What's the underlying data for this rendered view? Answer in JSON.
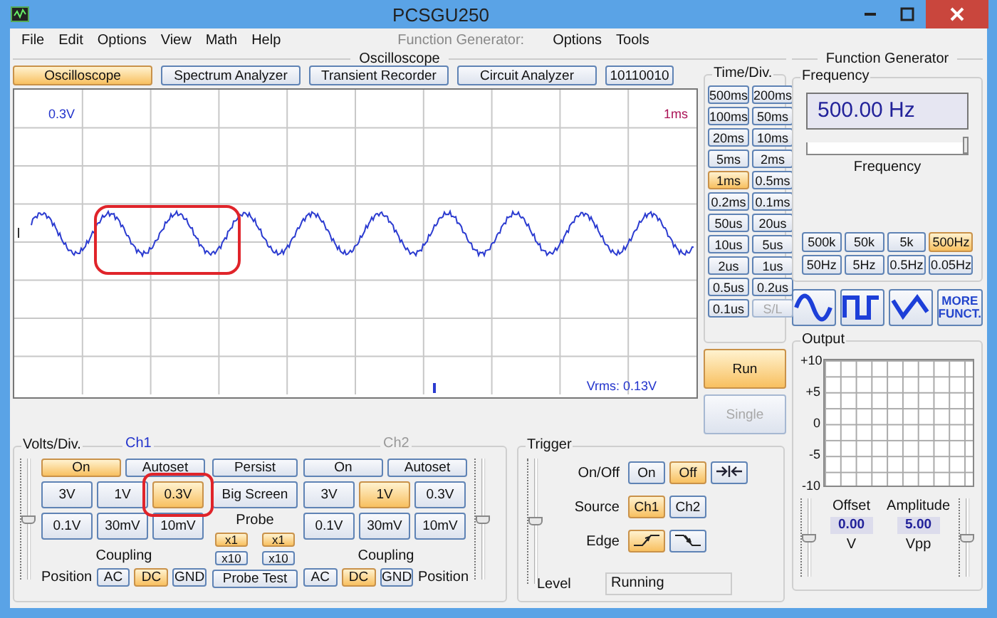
{
  "window": {
    "title": "PCSGU250"
  },
  "menu": [
    "File",
    "Edit",
    "Options",
    "View",
    "Math",
    "Help"
  ],
  "fg_menu": {
    "title": "Function Generator:",
    "items": [
      "Options",
      "Tools"
    ]
  },
  "oscilloscope": {
    "title": "Oscilloscope",
    "tabs": [
      {
        "label": "Oscilloscope",
        "selected": true
      },
      {
        "label": "Spectrum Analyzer",
        "selected": false
      },
      {
        "label": "Transient Recorder",
        "selected": false
      },
      {
        "label": "Circuit Analyzer",
        "selected": false
      },
      {
        "label": "10110010",
        "selected": false
      }
    ],
    "display": {
      "volts_label": "0.3V",
      "time_label": "1ms",
      "vrms": "Vrms: 0.13V",
      "highlight": true
    }
  },
  "time_div": {
    "title": "Time/Div.",
    "buttons": [
      {
        "label": "500ms",
        "selected": false,
        "disabled": false
      },
      {
        "label": "200ms",
        "selected": false,
        "disabled": false
      },
      {
        "label": "100ms",
        "selected": false,
        "disabled": false
      },
      {
        "label": "50ms",
        "selected": false,
        "disabled": false
      },
      {
        "label": "20ms",
        "selected": false,
        "disabled": false
      },
      {
        "label": "10ms",
        "selected": false,
        "disabled": false
      },
      {
        "label": "5ms",
        "selected": false,
        "disabled": false
      },
      {
        "label": "2ms",
        "selected": false,
        "disabled": false
      },
      {
        "label": "1ms",
        "selected": true,
        "disabled": false
      },
      {
        "label": "0.5ms",
        "selected": false,
        "disabled": false
      },
      {
        "label": "0.2ms",
        "selected": false,
        "disabled": false
      },
      {
        "label": "0.1ms",
        "selected": false,
        "disabled": false
      },
      {
        "label": "50us",
        "selected": false,
        "disabled": false
      },
      {
        "label": "20us",
        "selected": false,
        "disabled": false
      },
      {
        "label": "10us",
        "selected": false,
        "disabled": false
      },
      {
        "label": "5us",
        "selected": false,
        "disabled": false
      },
      {
        "label": "2us",
        "selected": false,
        "disabled": false
      },
      {
        "label": "1us",
        "selected": false,
        "disabled": false
      },
      {
        "label": "0.5us",
        "selected": false,
        "disabled": false
      },
      {
        "label": "0.2us",
        "selected": false,
        "disabled": false
      },
      {
        "label": "0.1us",
        "selected": false,
        "disabled": false
      },
      {
        "label": "S/L",
        "selected": false,
        "disabled": true
      }
    ],
    "run": {
      "label": "Run",
      "selected": true,
      "disabled": false
    },
    "single": {
      "label": "Single",
      "selected": false,
      "disabled": true
    }
  },
  "volts_div": {
    "title": "Volts/Div.",
    "channels": [
      {
        "title": "Ch1",
        "enabled": true,
        "slider": {
          "level": 0.5
        },
        "on": {
          "label": "On",
          "selected": true
        },
        "autoset": {
          "label": "Autoset"
        },
        "ranges": [
          {
            "label": "3V",
            "selected": false,
            "highlight": false
          },
          {
            "label": "1V",
            "selected": false,
            "highlight": false
          },
          {
            "label": "0.3V",
            "selected": true,
            "highlight": true
          },
          {
            "label": "0.1V",
            "selected": false,
            "highlight": false
          },
          {
            "label": "30mV",
            "selected": false,
            "highlight": false
          },
          {
            "label": "10mV",
            "selected": false,
            "highlight": false
          }
        ],
        "coupling_label": "Coupling",
        "coupling": [
          {
            "label": "AC",
            "selected": false
          },
          {
            "label": "DC",
            "selected": true
          },
          {
            "label": "GND",
            "selected": false
          }
        ],
        "position_label": "Position"
      },
      {
        "title": "Ch2",
        "enabled": false,
        "slider": {
          "level": 0.5
        },
        "on": {
          "label": "On",
          "selected": false
        },
        "autoset": {
          "label": "Autoset"
        },
        "ranges": [
          {
            "label": "3V",
            "selected": false,
            "highlight": false
          },
          {
            "label": "1V",
            "selected": true,
            "highlight": false
          },
          {
            "label": "0.3V",
            "selected": false,
            "highlight": false
          },
          {
            "label": "0.1V",
            "selected": false,
            "highlight": false
          },
          {
            "label": "30mV",
            "selected": false,
            "highlight": false
          },
          {
            "label": "10mV",
            "selected": false,
            "highlight": false
          }
        ],
        "coupling_label": "Coupling",
        "coupling": [
          {
            "label": "AC",
            "selected": false
          },
          {
            "label": "DC",
            "selected": true
          },
          {
            "label": "GND",
            "selected": false
          }
        ],
        "position_label": "Position"
      }
    ],
    "persist": "Persist",
    "big_screen": "Big Screen",
    "probe": {
      "title": "Probe",
      "options": [
        {
          "label": "x1",
          "selected": true
        },
        {
          "label": "x1",
          "selected": true
        },
        {
          "label": "x10",
          "selected": false
        },
        {
          "label": "x10",
          "selected": false
        }
      ],
      "test": "Probe Test"
    }
  },
  "trigger": {
    "title": "Trigger",
    "slider": {
      "level": 0.5
    },
    "onoff_label": "On/Off",
    "onoff": [
      {
        "label": "On",
        "selected": false
      },
      {
        "label": "Off",
        "selected": true
      }
    ],
    "source_label": "Source",
    "source": [
      {
        "label": "Ch1",
        "selected": true
      },
      {
        "label": "Ch2",
        "selected": false
      }
    ],
    "edge_label": "Edge",
    "edges": [
      {
        "kind": "rising",
        "selected": true
      },
      {
        "kind": "falling",
        "selected": false
      }
    ],
    "level_label": "Level",
    "status": "Running"
  },
  "function_generator": {
    "title": "Function Generator",
    "frequency": {
      "title": "Frequency",
      "display": "500.00 Hz",
      "slider_label": "Frequency",
      "slider": {
        "level": 1
      },
      "ranges": [
        {
          "label": "500k",
          "selected": false
        },
        {
          "label": "50k",
          "selected": false
        },
        {
          "label": "5k",
          "selected": false
        },
        {
          "label": "500Hz",
          "selected": true
        },
        {
          "label": "50Hz",
          "selected": false
        },
        {
          "label": "5Hz",
          "selected": false
        },
        {
          "label": "0.5Hz",
          "selected": false
        },
        {
          "label": "0.05Hz",
          "selected": false
        }
      ]
    },
    "waveforms": [
      {
        "kind": "sine"
      },
      {
        "kind": "square"
      },
      {
        "kind": "triangle"
      },
      {
        "kind": "more",
        "label": "MORE FUNCT."
      }
    ],
    "output": {
      "title": "Output",
      "y_labels": [
        "+10",
        "+5",
        "0",
        "-5",
        "-10"
      ],
      "offset": {
        "label": "Offset",
        "value": "0.00",
        "unit": "V",
        "level": 0.5
      },
      "amplitude": {
        "label": "Amplitude",
        "value": "5.00",
        "unit": "Vpp",
        "level": 0.5
      }
    }
  }
}
